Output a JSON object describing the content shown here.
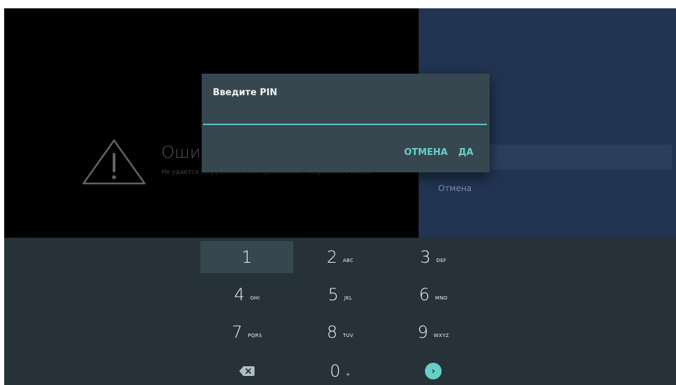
{
  "background_screen": {
    "error_title": "Ошибка",
    "error_description": "Не удается загрузить список приложений. Попробовать снова?",
    "right_panel": {
      "cancel_label": "Отмена"
    }
  },
  "dialog": {
    "title": "Введите PIN",
    "pin_value": "",
    "cancel_label": "ОТМЕНА",
    "ok_label": "ДА"
  },
  "keypad": {
    "keys": [
      {
        "digit": "1",
        "letters": ""
      },
      {
        "digit": "2",
        "letters": "ABC"
      },
      {
        "digit": "3",
        "letters": "DEF"
      },
      {
        "digit": "4",
        "letters": "GHI"
      },
      {
        "digit": "5",
        "letters": "JKL"
      },
      {
        "digit": "6",
        "letters": "MNO"
      },
      {
        "digit": "7",
        "letters": "PQRS"
      },
      {
        "digit": "8",
        "letters": "TUV"
      },
      {
        "digit": "9",
        "letters": "WXYZ"
      },
      {
        "digit": "0",
        "letters": "+"
      }
    ],
    "backspace_icon": "backspace-icon",
    "enter_icon": "chevron-right-icon",
    "focused_key": "1"
  },
  "colors": {
    "accent": "#64d0c8",
    "dialog_bg": "#37474f",
    "keypad_bg": "#263238",
    "right_panel_bg": "#213451"
  }
}
